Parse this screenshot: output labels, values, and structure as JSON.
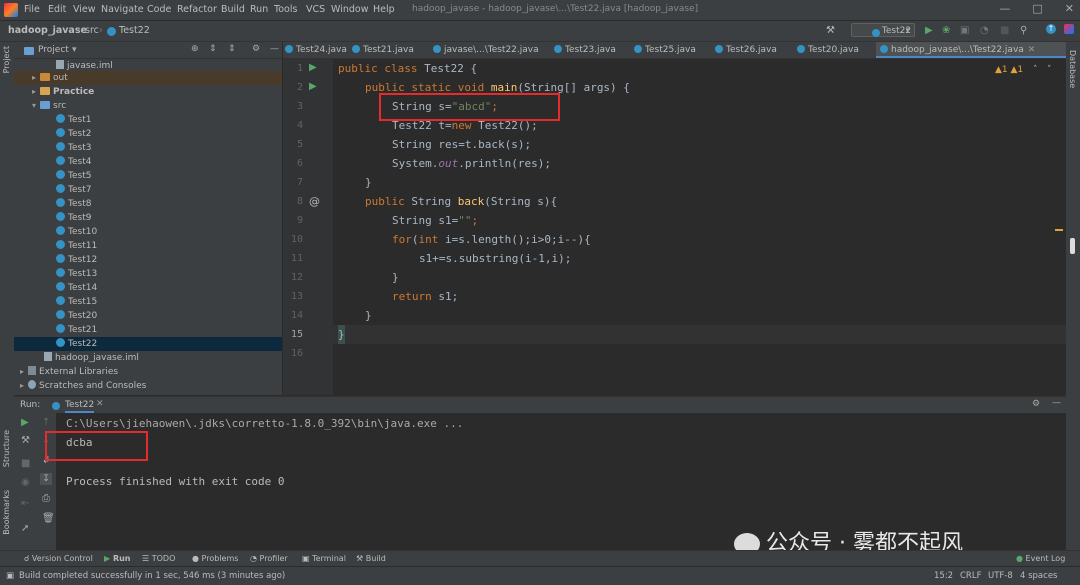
{
  "menubar": {
    "items": [
      "File",
      "Edit",
      "View",
      "Navigate",
      "Code",
      "Refactor",
      "Build",
      "Run",
      "Tools",
      "VCS",
      "Window",
      "Help"
    ],
    "window_title": "hadoop_javase - hadoop_javase\\...\\Test22.java [hadoop_javase]"
  },
  "navbar": {
    "project": "hadoop_javase",
    "folder": "src",
    "file": "Test22",
    "run_config": "Test22"
  },
  "project_panel": {
    "title": "Project",
    "items": [
      {
        "label": "javase.iml",
        "type": "iml"
      },
      {
        "label": "out",
        "type": "folder-orange"
      },
      {
        "label": "Practice",
        "type": "folder"
      },
      {
        "label": "src",
        "type": "folder-blue"
      },
      {
        "label": "Test1",
        "type": "class"
      },
      {
        "label": "Test2",
        "type": "class"
      },
      {
        "label": "Test3",
        "type": "class"
      },
      {
        "label": "Test4",
        "type": "class"
      },
      {
        "label": "Test5",
        "type": "class"
      },
      {
        "label": "Test7",
        "type": "class"
      },
      {
        "label": "Test8",
        "type": "class"
      },
      {
        "label": "Test9",
        "type": "class"
      },
      {
        "label": "Test10",
        "type": "class"
      },
      {
        "label": "Test11",
        "type": "class"
      },
      {
        "label": "Test12",
        "type": "class"
      },
      {
        "label": "Test13",
        "type": "class"
      },
      {
        "label": "Test14",
        "type": "class"
      },
      {
        "label": "Test15",
        "type": "class"
      },
      {
        "label": "Test20",
        "type": "class"
      },
      {
        "label": "Test21",
        "type": "class"
      },
      {
        "label": "Test22",
        "type": "class",
        "selected": true
      },
      {
        "label": "hadoop_javase.iml",
        "type": "iml"
      },
      {
        "label": "External Libraries",
        "type": "lib"
      },
      {
        "label": "Scratches and Consoles",
        "type": "scratch"
      }
    ]
  },
  "tabs": [
    {
      "label": "Test24.java"
    },
    {
      "label": "Test21.java"
    },
    {
      "label": "javase\\...\\Test22.java"
    },
    {
      "label": "Test23.java"
    },
    {
      "label": "Test25.java"
    },
    {
      "label": "Test26.java"
    },
    {
      "label": "Test20.java"
    },
    {
      "label": "hadoop_javase\\...\\Test22.java",
      "active": true
    }
  ],
  "editor": {
    "line_numbers": [
      "1",
      "2",
      "3",
      "4",
      "5",
      "6",
      "7",
      "8",
      "9",
      "10",
      "11",
      "12",
      "13",
      "14",
      "15",
      "16"
    ],
    "current_line": "15",
    "inspection": "▲1  ▲1",
    "lines": {
      "l1_kw": "public class ",
      "l1_name": "Test22 {",
      "l2_kw": "public static void ",
      "l2_fn": "main",
      "l2_rest": "(String[] args) {",
      "l3_a": "String s=",
      "l3_str": "\"abcd\"",
      "l3_end": ";",
      "l4_a": "Test22 t=",
      "l4_kw": "new ",
      "l4_rest": "Test22();",
      "l5": "String res=t.back(s);",
      "l6_a": "System.",
      "l6_it": "out",
      "l6_rest": ".println(res);",
      "l7": "}",
      "l8_kw": "public ",
      "l8_a": "String ",
      "l8_fn": "back",
      "l8_rest": "(String s){",
      "l9_a": "String s1=",
      "l9_str": "\"\"",
      "l9_end": ";",
      "l10_kw": "for",
      "l10_a": "(",
      "l10_kw2": "int ",
      "l10_rest": "i=s.length();i>0;i--){",
      "l11": "s1+=s.substring(i-1,i);",
      "l12": "}",
      "l13_kw": "return ",
      "l13_rest": "s1;",
      "l14": "}",
      "l15": "}"
    }
  },
  "run_panel": {
    "label": "Run:",
    "tab": "Test22",
    "command": "C:\\Users\\jiehaowen\\.jdks\\corretto-1.8.0_392\\bin\\java.exe ...",
    "output": "dcba",
    "exit": "Process finished with exit code 0"
  },
  "watermark": "公众号 · 雾都不起风",
  "left_strip": [
    "Project",
    "Structure",
    "Bookmarks"
  ],
  "right_strip": [
    "Database"
  ],
  "tool_windows": [
    "Version Control",
    "Run",
    "TODO",
    "Problems",
    "Profiler",
    "Terminal",
    "Build"
  ],
  "event_log": "Event Log",
  "status": {
    "message": "Build completed successfully in 1 sec, 546 ms (3 minutes ago)",
    "position": "15:2",
    "line_sep": "CRLF",
    "encoding": "UTF-8",
    "indent": "4 spaces"
  },
  "colors": {
    "accent": "#4a88c7",
    "highlight_box": "#e52b2b",
    "run_green": "#59a869"
  }
}
